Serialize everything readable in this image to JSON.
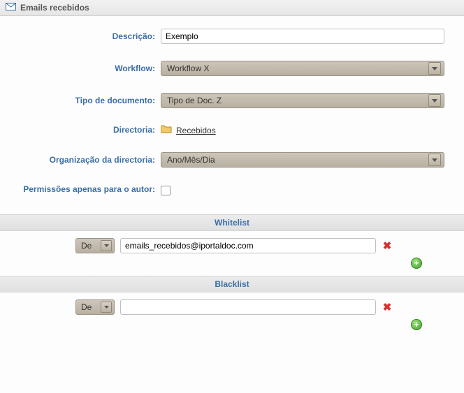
{
  "header": {
    "title": "Emails recebidos"
  },
  "labels": {
    "descricao": "Descrição:",
    "workflow": "Workflow:",
    "tipoDoc": "Tipo de documento:",
    "directoria": "Directoria:",
    "orgDir": "Organização da directoria:",
    "permAutor": "Permissões apenas para o autor:"
  },
  "fields": {
    "descricao": "Exemplo",
    "workflow": "Workflow X",
    "tipoDoc": "Tipo de Doc. Z",
    "directoria": "Recebidos",
    "orgDir": "Ano/Mês/Dia",
    "permAutor": false
  },
  "sections": {
    "whitelist": "Whitelist",
    "blacklist": "Blacklist"
  },
  "whitelist": {
    "rows": [
      {
        "field": "De",
        "value": "emails_recebidos@iportaldoc.com"
      }
    ]
  },
  "blacklist": {
    "rows": [
      {
        "field": "De",
        "value": ""
      }
    ]
  }
}
